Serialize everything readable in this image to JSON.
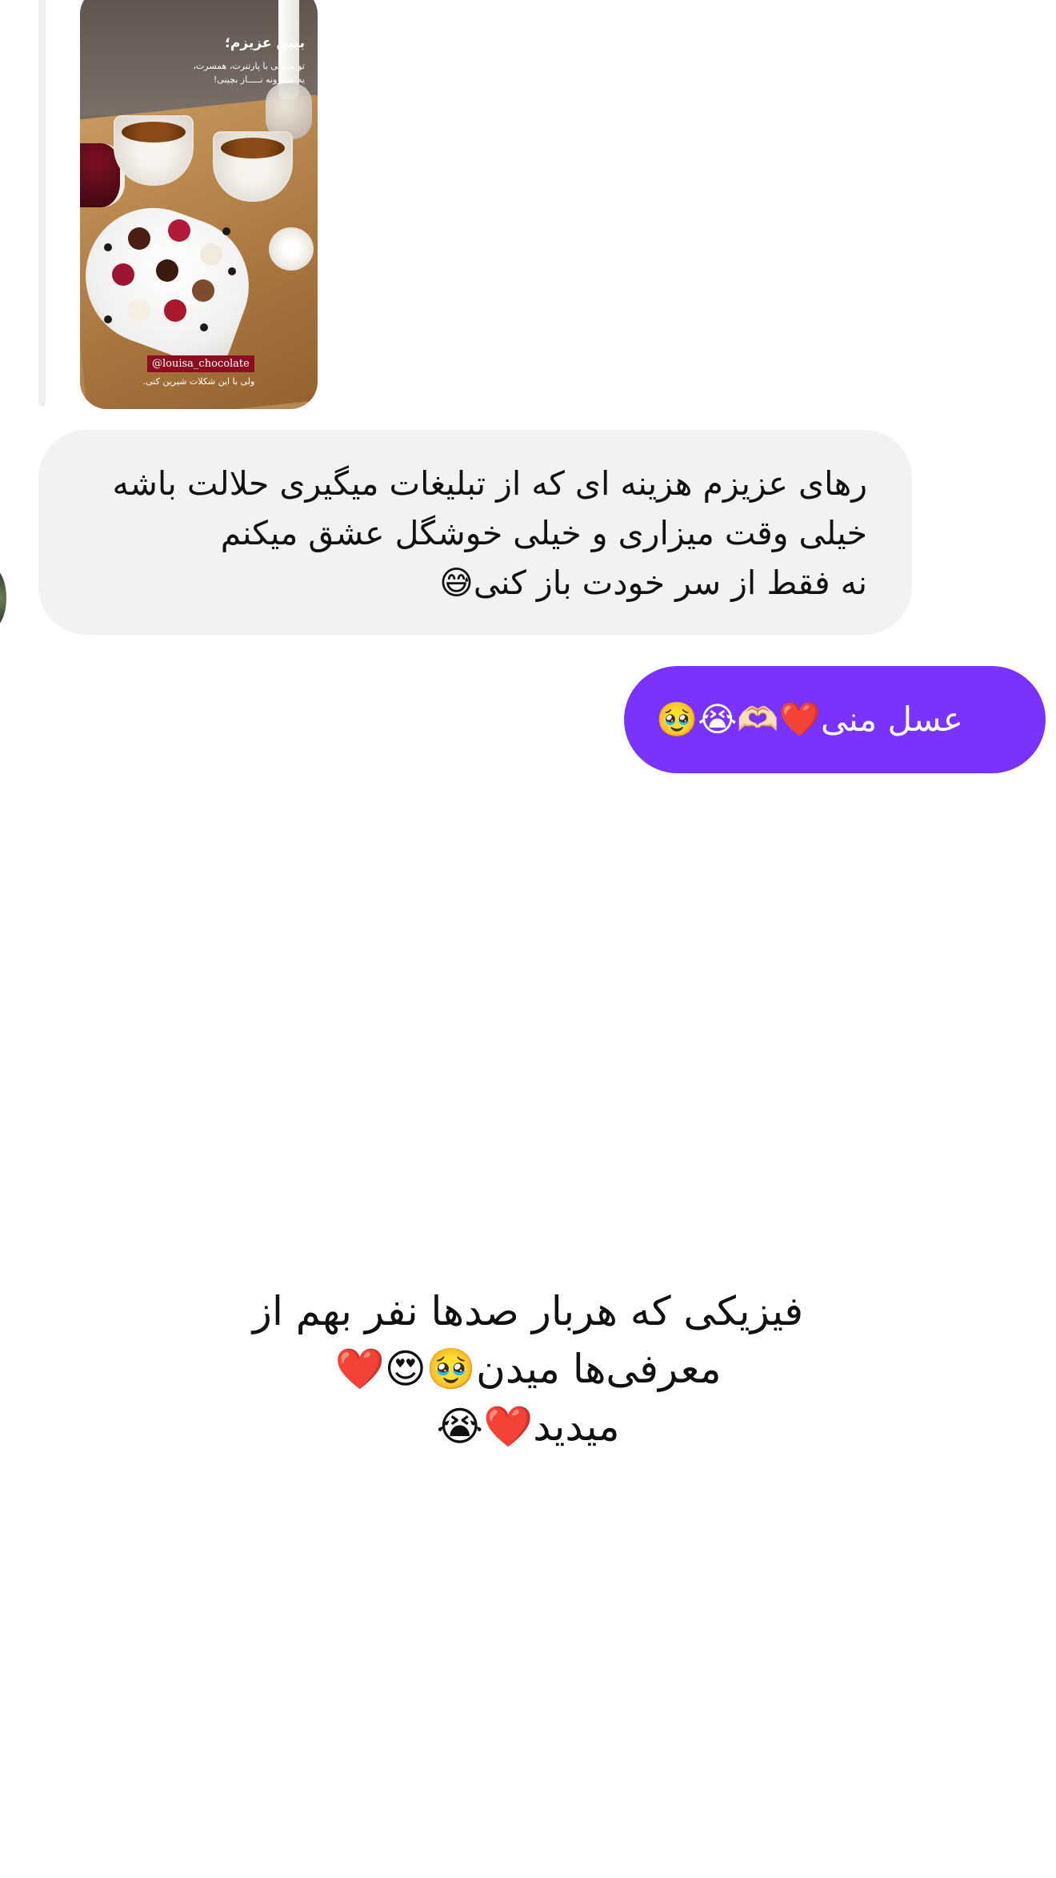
{
  "story_preview": {
    "title": "ببین عزیزم؛",
    "subtitle_line1": "تو میتونی با پارتنرت، همسرت،",
    "subtitle_line2": "یه عصرونه نـــــاز بچینی!",
    "handle": "@louisa_chocolate",
    "caption": "ولی با این شکلات شیرین کنی."
  },
  "received_message": {
    "line1": "رهای عزیزم هزینه ای که از تبلیغات میگیری حلالت باشه",
    "line2": "خیلی وقت میزاری و خیلی خوشگل عشق میکنم",
    "line3": "نه فقط از سر خودت باز کنی😅"
  },
  "sent_message": {
    "text": "عسل منی❤️🫶🏻😭🥹"
  },
  "center_caption": {
    "line1": "فیزیکی که هربار صدها نفر بهم از",
    "line2": "معرفی‌ها میدن🥹😍❤️",
    "line3": "میدید❤️😭"
  },
  "colors": {
    "sent_bubble": "#7a32ff",
    "received_bubble": "#f1f2f4",
    "background": "#ffffff"
  }
}
